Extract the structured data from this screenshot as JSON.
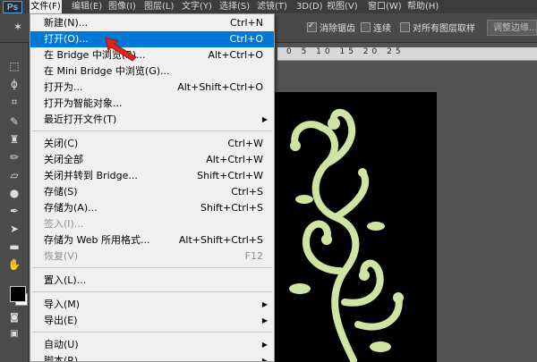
{
  "app": {
    "logo": "Ps"
  },
  "menubar": [
    {
      "label": "文件(F)"
    },
    {
      "label": "编辑(E)"
    },
    {
      "label": "图像(I)"
    },
    {
      "label": "图层(L)"
    },
    {
      "label": "文字(Y)"
    },
    {
      "label": "选择(S)"
    },
    {
      "label": "滤镜(T)"
    },
    {
      "label": "3D(D)"
    },
    {
      "label": "视图(V)"
    },
    {
      "label": "窗口(W)"
    },
    {
      "label": "帮助(H)"
    }
  ],
  "options": {
    "smooth": "消除锯齿",
    "contiguous": "连续",
    "all_layers": "对所有图层取样",
    "refine_edge": "调整边缘..."
  },
  "ruler": {
    "labels": "0 5 10 15 20 25"
  },
  "file_menu": [
    {
      "label": "新建(N)...",
      "shortcut": "Ctrl+N"
    },
    {
      "label": "打开(O)...",
      "shortcut": "Ctrl+O"
    },
    {
      "label": "在 Bridge 中浏览(B)...",
      "shortcut": "Alt+Ctrl+O"
    },
    {
      "label": "在 Mini Bridge 中浏览(G)...",
      "shortcut": ""
    },
    {
      "label": "打开为...",
      "shortcut": "Alt+Shift+Ctrl+O"
    },
    {
      "label": "打开为智能对象...",
      "shortcut": ""
    },
    {
      "label": "最近打开文件(T)",
      "shortcut": ""
    },
    {
      "label": "关闭(C)",
      "shortcut": "Ctrl+W"
    },
    {
      "label": "关闭全部",
      "shortcut": "Alt+Ctrl+W"
    },
    {
      "label": "关闭并转到 Bridge...",
      "shortcut": "Shift+Ctrl+W"
    },
    {
      "label": "存储(S)",
      "shortcut": "Ctrl+S"
    },
    {
      "label": "存储为(A)...",
      "shortcut": "Shift+Ctrl+S"
    },
    {
      "label": "签入(I)...",
      "shortcut": ""
    },
    {
      "label": "存储为 Web 所用格式...",
      "shortcut": "Alt+Shift+Ctrl+S"
    },
    {
      "label": "恢复(V)",
      "shortcut": "F12"
    },
    {
      "label": "置入(L)...",
      "shortcut": ""
    },
    {
      "label": "导入(M)",
      "shortcut": ""
    },
    {
      "label": "导出(E)",
      "shortcut": ""
    },
    {
      "label": "自动(U)",
      "shortcut": ""
    },
    {
      "label": "脚本(R)",
      "shortcut": ""
    }
  ],
  "colors": {
    "highlight": "#0078d7",
    "artwork": "#cfe3a3"
  }
}
